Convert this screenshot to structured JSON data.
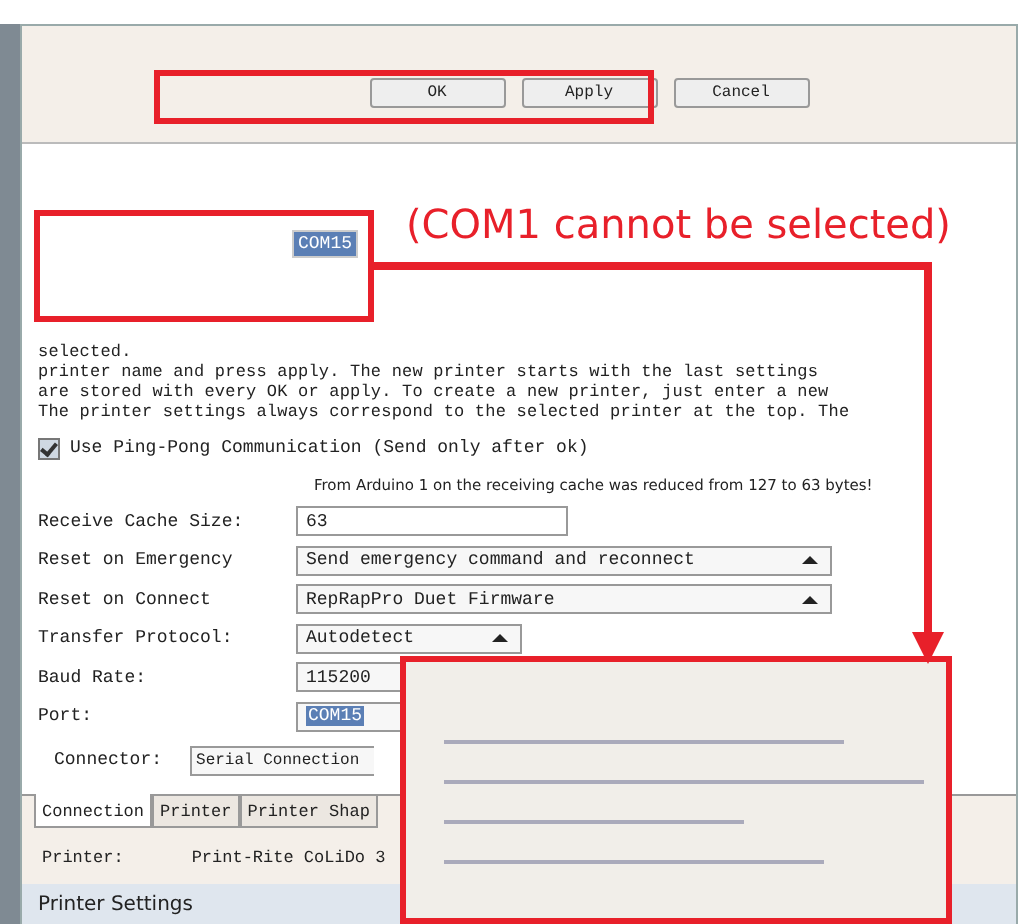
{
  "buttons": [
    "OK",
    "Apply",
    "Cancel"
  ],
  "annotation": "(COM1 cannot be selected)",
  "port_selection": "COM15",
  "description": [
    "selected.",
    "printer name and press apply. The new printer starts with the last settings",
    "are stored with every OK or apply. To create a new printer, just enter a new",
    "The printer settings always correspond to the selected printer at the top. The"
  ],
  "ping_pong": {
    "label": "Use Ping-Pong Communication (Send only after ok)",
    "checked": true
  },
  "note": "From Arduino 1 on the receiving cache was reduced from 127 to 63 bytes!",
  "settings": [
    {
      "label": "Receive Cache Size:",
      "value": "63",
      "kind": "text",
      "highlighted": false
    },
    {
      "label": "Reset on Emergency",
      "value": "Send emergency command and reconnect",
      "kind": "wide",
      "highlighted": false
    },
    {
      "label": "Reset on Connect",
      "value": "RepRapPro Duet Firmware",
      "kind": "wide",
      "highlighted": false
    },
    {
      "label": "Transfer Protocol:",
      "value": "Autodetect",
      "kind": "dropdown",
      "highlighted": false
    },
    {
      "label": "Baud Rate:",
      "value": "115200",
      "kind": "partial",
      "highlighted": false
    },
    {
      "label": "Port:",
      "value": "COM15",
      "kind": "partial",
      "highlighted": true
    }
  ],
  "connector": {
    "label": "Connector:",
    "value": "Serial Connection"
  },
  "tabs": [
    {
      "label": "Connection",
      "selected": true
    },
    {
      "label": "Printer",
      "selected": false
    },
    {
      "label": "Printer Shap",
      "selected": false
    }
  ],
  "printer": {
    "label": "Printer:",
    "value": "Print-Rite CoLiDo 3"
  },
  "window": {
    "title": "Printer Settings"
  }
}
